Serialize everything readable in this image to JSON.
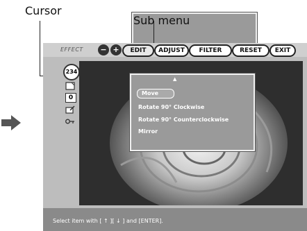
{
  "callouts": {
    "cursor": "Cursor",
    "submenu": "Sub menu"
  },
  "toolbar": {
    "effect_label": "EFFECT",
    "zoom_out_glyph": "−",
    "zoom_in_glyph": "+",
    "tabs": [
      "EDIT",
      "ADJUST",
      "FILTER",
      "RESET",
      "EXIT"
    ]
  },
  "sidebar": {
    "counter": "234",
    "value": "0"
  },
  "submenu": {
    "caret": "▲",
    "items": [
      "Move",
      "Rotate 90°  Clockwise",
      "Rotate 90°  Counterclockwise",
      "Mirror"
    ]
  },
  "status": {
    "text": "Select item with [ ↑ ][ ↓ ] and [ENTER]."
  },
  "colors": {
    "screen_bg": "#bdbdbd",
    "bottom_bar": "#8a8a8a",
    "submenu_bg": "#9a9a9a",
    "arrow": "#555555"
  }
}
